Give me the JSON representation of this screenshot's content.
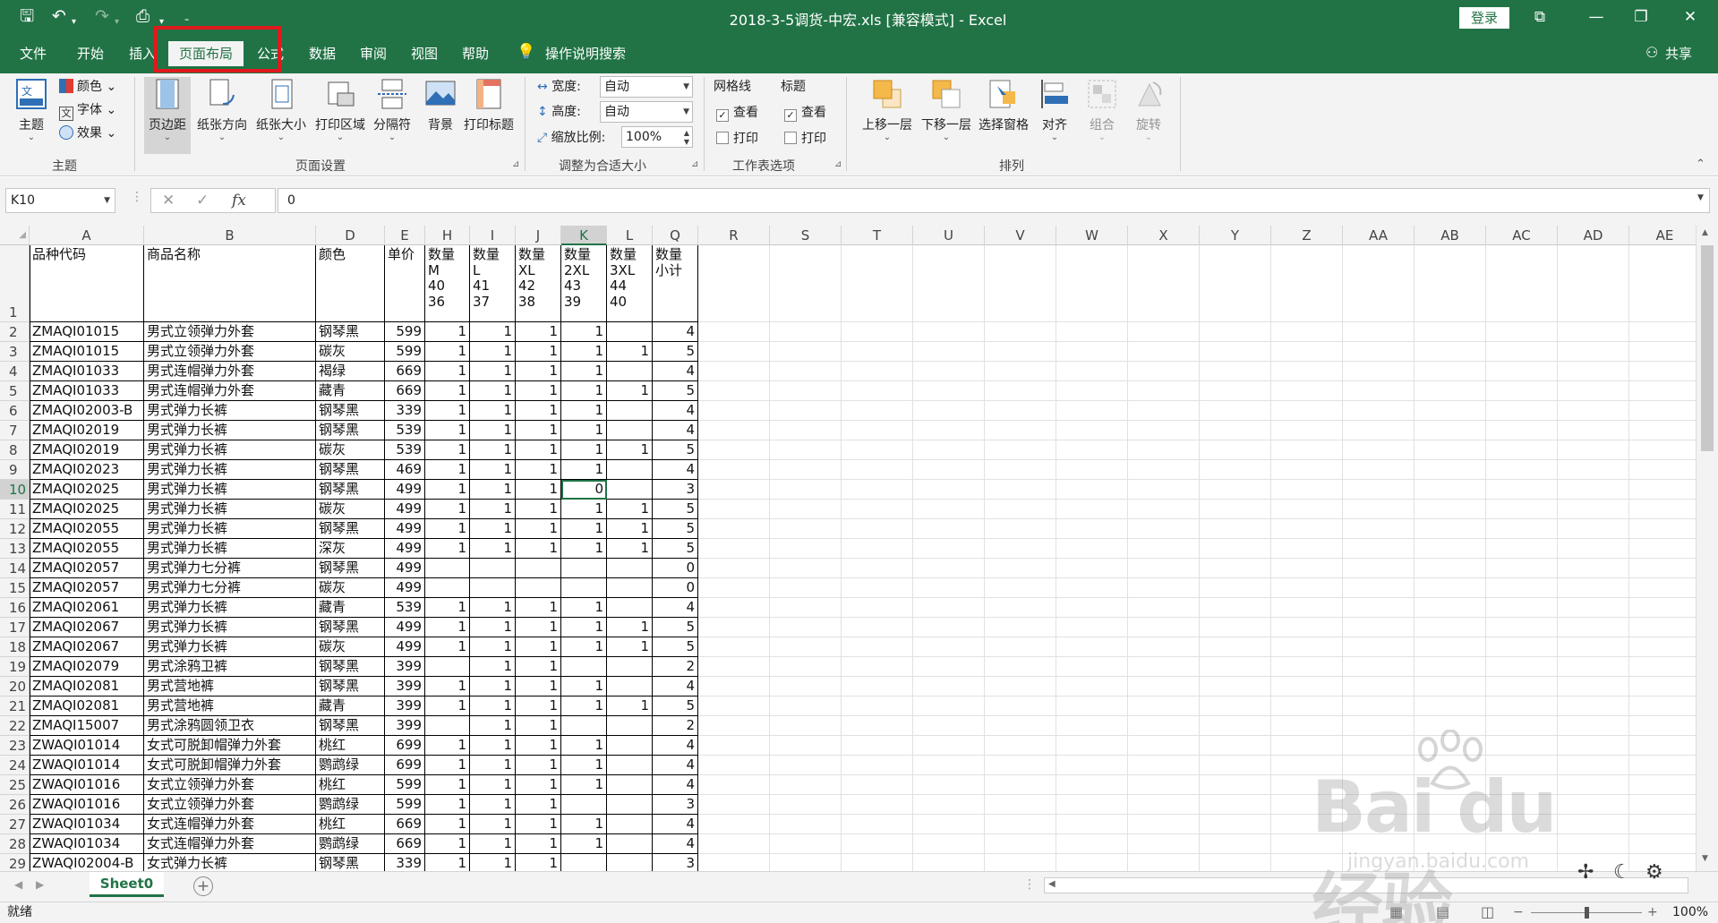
{
  "titlebar": {
    "title": "2018-3-5调货-中宏.xls  [兼容模式]  -  Excel",
    "login": "登录",
    "share": "共享"
  },
  "tabs": [
    "文件",
    "开始",
    "插入",
    "页面布局",
    "公式",
    "数据",
    "审阅",
    "视图",
    "帮助"
  ],
  "active_tab": "页面布局",
  "tell_me": "操作说明搜索",
  "ribbon": {
    "themes": {
      "label": "主题",
      "theme_btn": "主题",
      "colors": "颜色",
      "fonts": "字体",
      "effects": "效果"
    },
    "page_setup": {
      "label": "页面设置",
      "margins": "页边距",
      "orientation": "纸张方向",
      "size": "纸张大小",
      "print_area": "打印区域",
      "breaks": "分隔符",
      "background": "背景",
      "print_titles": "打印标题"
    },
    "scale": {
      "label": "调整为合适大小",
      "width_label": "宽度:",
      "width_value": "自动",
      "height_label": "高度:",
      "height_value": "自动",
      "scale_label": "缩放比例:",
      "scale_value": "100%"
    },
    "sheet_options": {
      "label": "工作表选项",
      "gridlines": "网格线",
      "headings": "标题",
      "view": "查看",
      "print": "打印"
    },
    "arrange": {
      "label": "排列",
      "bring_forward": "上移一层",
      "send_backward": "下移一层",
      "selection_pane": "选择窗格",
      "align": "对齐",
      "group": "组合",
      "rotate": "旋转"
    }
  },
  "formula_bar": {
    "name_box": "K10",
    "fx": "fx",
    "value": "0"
  },
  "columns": [
    "A",
    "B",
    "D",
    "E",
    "H",
    "I",
    "J",
    "K",
    "L",
    "Q",
    "R",
    "S",
    "T",
    "U",
    "V",
    "W",
    "X",
    "Y",
    "Z",
    "AA",
    "AB",
    "AC",
    "AD",
    "AE"
  ],
  "selected_column": "K",
  "header_row": {
    "row": "1",
    "cells": [
      "品种代码",
      "商品名称",
      "颜色",
      "单价",
      "数量\nM\n40\n36",
      "数量\nL\n41\n37",
      "数量\nXL\n42\n38",
      "数量\n2XL\n43\n39",
      "数量\n3XL\n44\n40",
      "数量\n小计"
    ]
  },
  "rows": [
    {
      "r": "2",
      "c": [
        "ZMAQI01015",
        "男式立领弹力外套",
        "钢琴黑",
        "599",
        "1",
        "1",
        "1",
        "1",
        "",
        "4"
      ]
    },
    {
      "r": "3",
      "c": [
        "ZMAQI01015",
        "男式立领弹力外套",
        "碳灰",
        "599",
        "1",
        "1",
        "1",
        "1",
        "1",
        "5"
      ]
    },
    {
      "r": "4",
      "c": [
        "ZMAQI01033",
        "男式连帽弹力外套",
        "褐绿",
        "669",
        "1",
        "1",
        "1",
        "1",
        "",
        "4"
      ]
    },
    {
      "r": "5",
      "c": [
        "ZMAQI01033",
        "男式连帽弹力外套",
        "藏青",
        "669",
        "1",
        "1",
        "1",
        "1",
        "1",
        "5"
      ]
    },
    {
      "r": "6",
      "c": [
        "ZMAQI02003-B",
        "男式弹力长裤",
        "钢琴黑",
        "339",
        "1",
        "1",
        "1",
        "1",
        "",
        "4"
      ]
    },
    {
      "r": "7",
      "c": [
        "ZMAQI02019",
        "男式弹力长裤",
        "钢琴黑",
        "539",
        "1",
        "1",
        "1",
        "1",
        "",
        "4"
      ]
    },
    {
      "r": "8",
      "c": [
        "ZMAQI02019",
        "男式弹力长裤",
        "碳灰",
        "539",
        "1",
        "1",
        "1",
        "1",
        "1",
        "5"
      ]
    },
    {
      "r": "9",
      "c": [
        "ZMAQI02023",
        "男式弹力长裤",
        "钢琴黑",
        "469",
        "1",
        "1",
        "1",
        "1",
        "",
        "4"
      ]
    },
    {
      "r": "10",
      "c": [
        "ZMAQI02025",
        "男式弹力长裤",
        "钢琴黑",
        "499",
        "1",
        "1",
        "1",
        "0",
        "",
        "3"
      ]
    },
    {
      "r": "11",
      "c": [
        "ZMAQI02025",
        "男式弹力长裤",
        "碳灰",
        "499",
        "1",
        "1",
        "1",
        "1",
        "1",
        "5"
      ]
    },
    {
      "r": "12",
      "c": [
        "ZMAQI02055",
        "男式弹力长裤",
        "钢琴黑",
        "499",
        "1",
        "1",
        "1",
        "1",
        "1",
        "5"
      ]
    },
    {
      "r": "13",
      "c": [
        "ZMAQI02055",
        "男式弹力长裤",
        "深灰",
        "499",
        "1",
        "1",
        "1",
        "1",
        "1",
        "5"
      ]
    },
    {
      "r": "14",
      "c": [
        "ZMAQI02057",
        "男式弹力七分裤",
        "钢琴黑",
        "499",
        "",
        "",
        "",
        "",
        "",
        "0"
      ]
    },
    {
      "r": "15",
      "c": [
        "ZMAQI02057",
        "男式弹力七分裤",
        "碳灰",
        "499",
        "",
        "",
        "",
        "",
        "",
        "0"
      ]
    },
    {
      "r": "16",
      "c": [
        "ZMAQI02061",
        "男式弹力长裤",
        "藏青",
        "539",
        "1",
        "1",
        "1",
        "1",
        "",
        "4"
      ]
    },
    {
      "r": "17",
      "c": [
        "ZMAQI02067",
        "男式弹力长裤",
        "钢琴黑",
        "499",
        "1",
        "1",
        "1",
        "1",
        "1",
        "5"
      ]
    },
    {
      "r": "18",
      "c": [
        "ZMAQI02067",
        "男式弹力长裤",
        "碳灰",
        "499",
        "1",
        "1",
        "1",
        "1",
        "1",
        "5"
      ]
    },
    {
      "r": "19",
      "c": [
        "ZMAQI02079",
        "男式涂鸦卫裤",
        "钢琴黑",
        "399",
        "",
        "1",
        "1",
        "",
        "",
        "2"
      ]
    },
    {
      "r": "20",
      "c": [
        "ZMAQI02081",
        "男式营地裤",
        "钢琴黑",
        "399",
        "1",
        "1",
        "1",
        "1",
        "",
        "4"
      ]
    },
    {
      "r": "21",
      "c": [
        "ZMAQI02081",
        "男式营地裤",
        "藏青",
        "399",
        "1",
        "1",
        "1",
        "1",
        "1",
        "5"
      ]
    },
    {
      "r": "22",
      "c": [
        "ZMAQI15007",
        "男式涂鸦圆领卫衣",
        "钢琴黑",
        "399",
        "",
        "1",
        "1",
        "",
        "",
        "2"
      ]
    },
    {
      "r": "23",
      "c": [
        "ZWAQI01014",
        "女式可脱卸帽弹力外套",
        "桃红",
        "699",
        "1",
        "1",
        "1",
        "1",
        "",
        "4"
      ]
    },
    {
      "r": "24",
      "c": [
        "ZWAQI01014",
        "女式可脱卸帽弹力外套",
        "鹦鹉绿",
        "699",
        "1",
        "1",
        "1",
        "1",
        "",
        "4"
      ]
    },
    {
      "r": "25",
      "c": [
        "ZWAQI01016",
        "女式立领弹力外套",
        "桃红",
        "599",
        "1",
        "1",
        "1",
        "1",
        "",
        "4"
      ]
    },
    {
      "r": "26",
      "c": [
        "ZWAQI01016",
        "女式立领弹力外套",
        "鹦鹉绿",
        "599",
        "1",
        "1",
        "1",
        "",
        "",
        "3"
      ]
    },
    {
      "r": "27",
      "c": [
        "ZWAQI01034",
        "女式连帽弹力外套",
        "桃红",
        "669",
        "1",
        "1",
        "1",
        "1",
        "",
        "4"
      ]
    },
    {
      "r": "28",
      "c": [
        "ZWAQI01034",
        "女式连帽弹力外套",
        "鹦鹉绿",
        "669",
        "1",
        "1",
        "1",
        "1",
        "",
        "4"
      ]
    },
    {
      "r": "29",
      "c": [
        "ZWAQI02004-B",
        "女式弹力长裤",
        "钢琴黑",
        "339",
        "1",
        "1",
        "1",
        "",
        "",
        "3"
      ]
    }
  ],
  "sheet_tab": "Sheet0",
  "status": {
    "ready": "就绪",
    "zoom": "100%"
  },
  "watermark": {
    "brand": "Bai du 经验",
    "url": "jingyan.baidu.com"
  },
  "colors": {
    "excel_green": "#217346",
    "highlight_red": "#e0191d"
  }
}
